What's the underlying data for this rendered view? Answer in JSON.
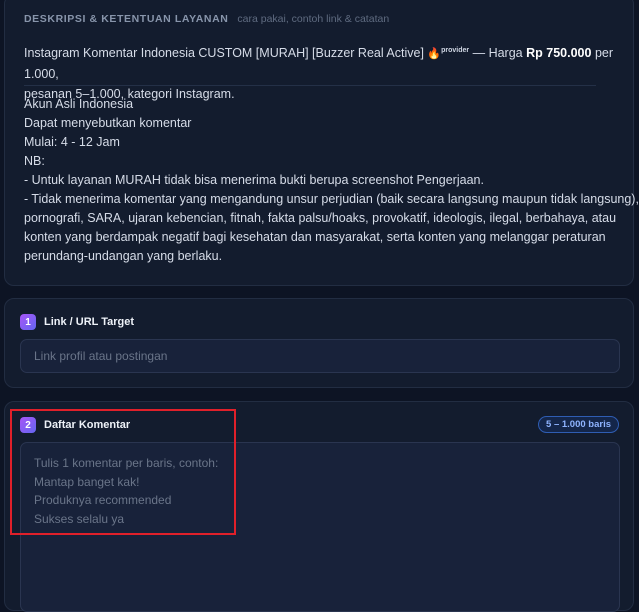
{
  "description": {
    "section_title": "DESKRIPSI & KETENTUAN LAYANAN",
    "section_subtitle": "cara pakai, contoh link & catatan",
    "summary": {
      "service_name": "Instagram Komentar Indonesia CUSTOM [MURAH] [Buzzer Real Active]",
      "fire_glyph": "🔥",
      "provider_tag": "provider",
      "price_prefix": "— Harga",
      "price": "Rp 750.000",
      "price_suffix": "per 1.000,",
      "details": "pesanan 5–1.000, kategori Instagram."
    },
    "lines": [
      "Akun Asli Indonesia",
      "Dapat menyebutkan komentar",
      "Mulai: 4 - 12 Jam",
      "NB:",
      "- Untuk layanan MURAH tidak bisa menerima bukti berupa screenshot Pengerjaan.",
      "- Tidak menerima komentar yang mengandung unsur perjudian (baik secara langsung maupun tidak langsung),",
      "pornografi, SARA, ujaran kebencian, fitnah, fakta palsu/hoaks, provokatif, ideologis, ilegal, berbahaya, atau",
      "konten yang berdampak negatif bagi kesehatan dan masyarakat, serta konten yang melanggar peraturan",
      "perundang-undangan yang berlaku."
    ]
  },
  "link_field": {
    "step": "1",
    "label": "Link / URL Target",
    "value": "",
    "placeholder": "Link profil atau postingan"
  },
  "comment_field": {
    "step": "2",
    "label": "Daftar Komentar",
    "badge": "5 – 1.000 baris",
    "value": "",
    "placeholder": "Tulis 1 komentar per baris, contoh:\nMantap banget kak!\nProduknya recommended\nSukses selalu ya"
  },
  "colors": {
    "background": "#0d1424",
    "card": "#131c2e",
    "accent": "#8b5cf6",
    "badge_text": "#8fb4ff",
    "highlight": "#e0202a"
  }
}
